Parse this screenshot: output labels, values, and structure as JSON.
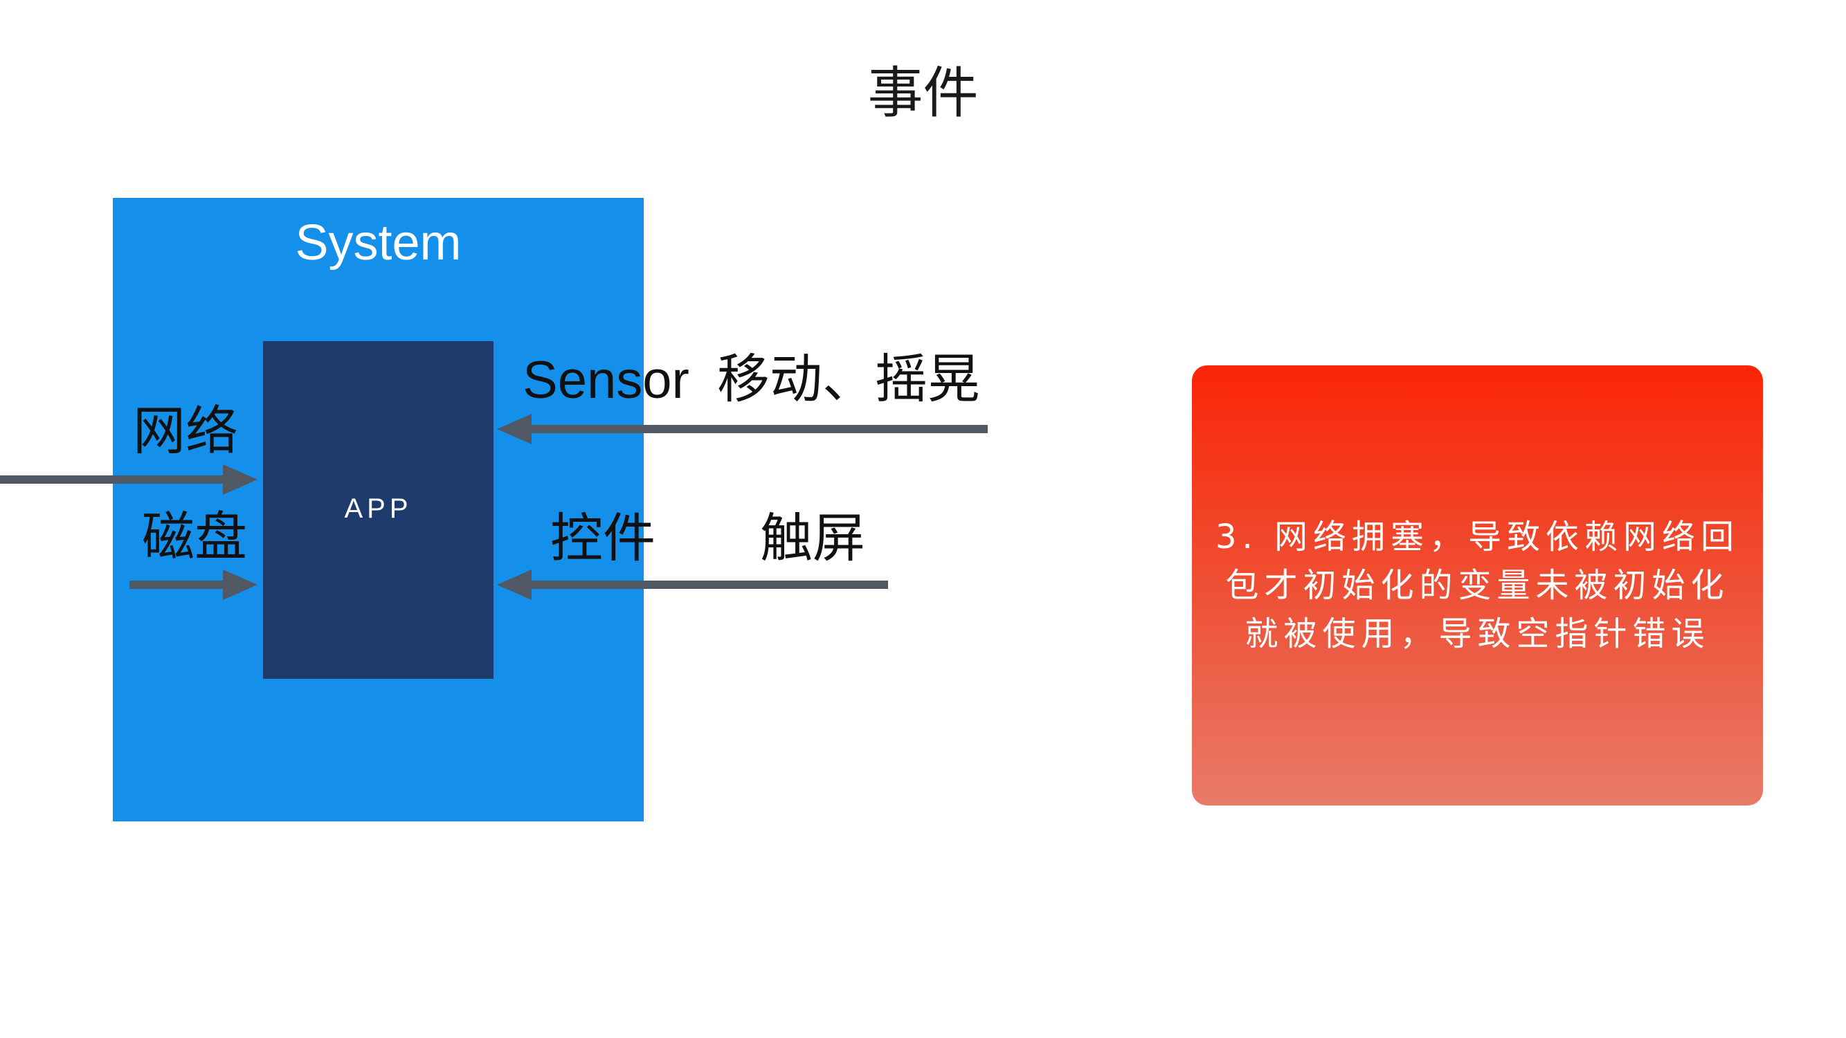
{
  "slide": {
    "title": "事件"
  },
  "diagram": {
    "system_label": "System",
    "app_label": "APP",
    "events": {
      "network": "网络",
      "disk": "磁盘",
      "sensor_prefix": "Sensor",
      "sensor_detail": "移动、摇晃",
      "controls": "控件",
      "touchscreen": "触屏"
    }
  },
  "callout": {
    "text": "3. 网络拥塞，导致依赖网络回包才初始化的变量未被初始化就被使用，导致空指针错误"
  },
  "colors": {
    "system": "#1590ea",
    "app": "#1e3b6d",
    "arrow": "#4f5863",
    "callout_top": "#fb2508",
    "callout_bottom": "#e87a68"
  }
}
